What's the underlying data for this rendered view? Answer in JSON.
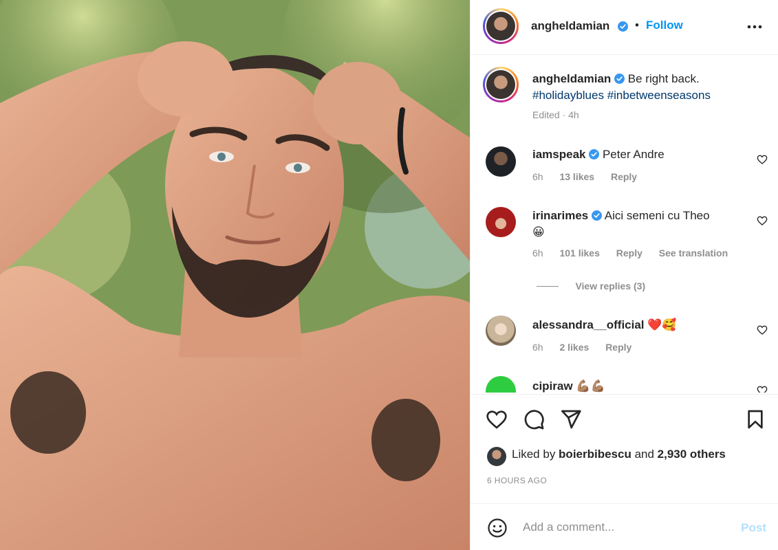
{
  "post": {
    "author": "angheldamian",
    "follow_label": "Follow",
    "separator": "•",
    "more_icon": "more-horizontal-icon"
  },
  "caption": {
    "username": "angheldamian",
    "text": "Be right back.",
    "hashtags": "#holidayblues #inbetweenseasons",
    "meta": "Edited · 4h"
  },
  "comments": [
    {
      "username": "iamspeak",
      "verified": true,
      "text": "Peter Andre",
      "time": "6h",
      "likes": "13 likes",
      "reply": "Reply"
    },
    {
      "username": "irinarimes",
      "verified": true,
      "text": "Aici semeni cu Theo",
      "emoji": "😀",
      "time": "6h",
      "likes": "101 likes",
      "reply": "Reply",
      "translate": "See translation",
      "view_replies": "View replies (3)"
    },
    {
      "username": "alessandra__official",
      "verified": false,
      "text": "❤️🥰",
      "time": "6h",
      "likes": "2 likes",
      "reply": "Reply"
    },
    {
      "username": "cipiraw",
      "verified": false,
      "text": "💪🏽💪🏽"
    }
  ],
  "likes": {
    "prefix": "Liked by ",
    "user": "boierbibescu",
    "middle": " and ",
    "others": "2,930 others"
  },
  "timestamp": "6 HOURS AGO",
  "add_comment": {
    "placeholder": "Add a comment...",
    "post_label": "Post"
  },
  "colors": {
    "link_blue": "#0095f6",
    "hashtag_blue": "#00376b",
    "muted_gray": "#8e8e8e",
    "verified_blue": "#3897f0",
    "heart_red": "#ed4956"
  }
}
